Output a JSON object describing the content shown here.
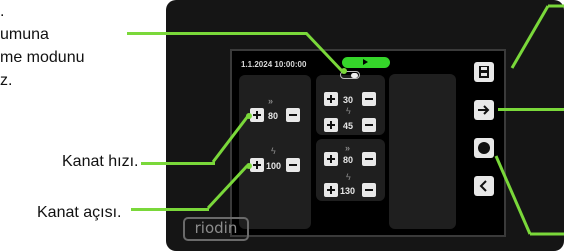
{
  "callouts": {
    "top_left_lines": [
      ".",
      "umuna",
      "me modunu",
      "z."
    ],
    "fan_speed": "Kanat hızı.",
    "fan_angle": "Kanat açısı."
  },
  "screen": {
    "datetime": "1.1.2024 10:00:00",
    "left_panel": {
      "speed_value": "80",
      "angle_value": "100"
    },
    "middle_panel": {
      "group1": {
        "top_value": "30",
        "bottom_value": "45"
      },
      "group2": {
        "top_value": "80",
        "bottom_value": "130"
      }
    }
  },
  "logo_text": "riodin",
  "colors": {
    "accent": "#7ad83a",
    "status_green": "#35d62a",
    "device": "#151515"
  },
  "icons": [
    "save-icon",
    "arrow-right-icon",
    "circle-icon",
    "chevron-left-icon",
    "chevrons-up-icon",
    "bolt-icon"
  ]
}
